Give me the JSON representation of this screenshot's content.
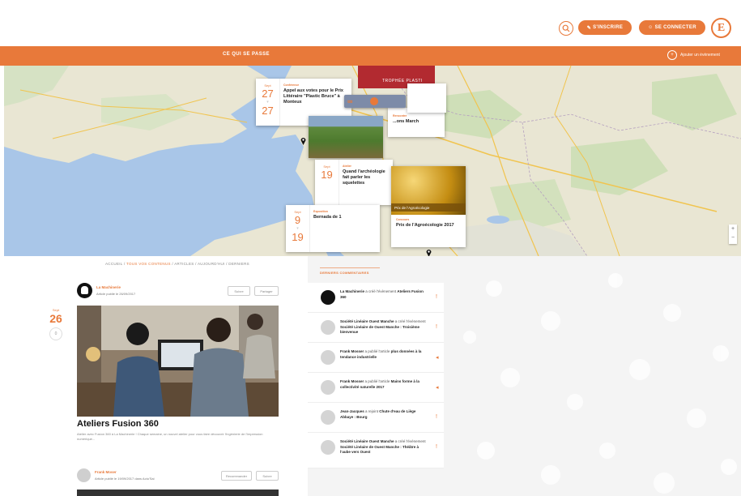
{
  "header": {
    "btn_inscription": "S'inscrire",
    "btn_connexion": "Se connecter",
    "logo_letter": "E"
  },
  "banner": {
    "title": "Ce qui se passe",
    "right_link": "Ajouter un évènement"
  },
  "map": {
    "red_banner": "Trophée Plasti",
    "cards": [
      {
        "month": "Sept",
        "day1": "27",
        "day2": "27",
        "tag": "Conférence",
        "title": "Appel aux votes pour le Prix Littéraire \"Plastic Bruce\" à Monteux"
      },
      {
        "month": "Sept",
        "day1": "19",
        "day2": "",
        "tag": "Atelier",
        "title": "Quand l'archéologie fait parler les squelettes"
      },
      {
        "month": "Sept",
        "day1": "9",
        "day2": "19",
        "tag": "Exposition",
        "title": "Bernada de 1"
      },
      {
        "month": "",
        "day1": "",
        "day2": "",
        "tag": "Concours",
        "title": "Prix de l'Agroécologie 2017"
      },
      {
        "month": "",
        "day1": "",
        "day2": "",
        "tag": "Rencontre",
        "title": "...ons March"
      }
    ],
    "gold_caption": "Prix de l'Agroécologie"
  },
  "breadcrumb": {
    "home": "Accueil",
    "items": [
      "Tous vos contenus",
      "Articles",
      "Aujourd'hui",
      "Derniers"
    ]
  },
  "feed": {
    "date_month": "Sept",
    "date_day": "26",
    "date_count": "0",
    "post1": {
      "author": "La Machinerie",
      "meta": "Article publié le 26/09/2017",
      "btn_follow": "Suivre",
      "btn_share": "Partager",
      "title": "Ateliers Fusion 360",
      "excerpt": "Atelier avec Fusion 360 à La Machinerie ! Chaque semaine, un nouvel atelier pour vous faire découvrir l'ingénierie de l'impression numérique..."
    },
    "post2": {
      "author": "Frank Moser",
      "meta": "Article publié le 19/09/2017 dans Actu'Sai",
      "btn_follow": "Recommander",
      "btn_share": "Suivre"
    }
  },
  "sidebar": {
    "heading": "Derniers commentaires",
    "items": [
      {
        "who": "La Machinerie",
        "rest": " a créé l'évènement ",
        "target": "Ateliers Fusion 360",
        "icon": "!"
      },
      {
        "who": "Société Linéaire Ouest Manche",
        "rest": " a créé l'évènement ",
        "target": "Société Linéaire de Ouest Manche : Troisième bienvenue",
        "icon": "!"
      },
      {
        "who": "Frank Mosser",
        "rest": " a publié l'article ",
        "target": "plus données à la tendance industrielle",
        "icon": "◂"
      },
      {
        "who": "Frank Mosser",
        "rest": " a publié l'article ",
        "target": "Mains forme à la collectivité naturelle 2017",
        "icon": "◂"
      },
      {
        "who": "Jean-Jacques",
        "rest": " a rejoint ",
        "target": "Chute d'eau de Liège Abbaye : Bourg",
        "icon": "!"
      },
      {
        "who": "Société Linéaire Ouest Manche",
        "rest": " a créé l'évènement ",
        "target": "Société Linéaire de Ouest Manche : Théâtre à l'aube vers Ouest",
        "icon": "!"
      }
    ]
  },
  "colors": {
    "accent": "#e8793a",
    "map_water": "#a9c6e8",
    "map_land": "#e9e6d3"
  }
}
